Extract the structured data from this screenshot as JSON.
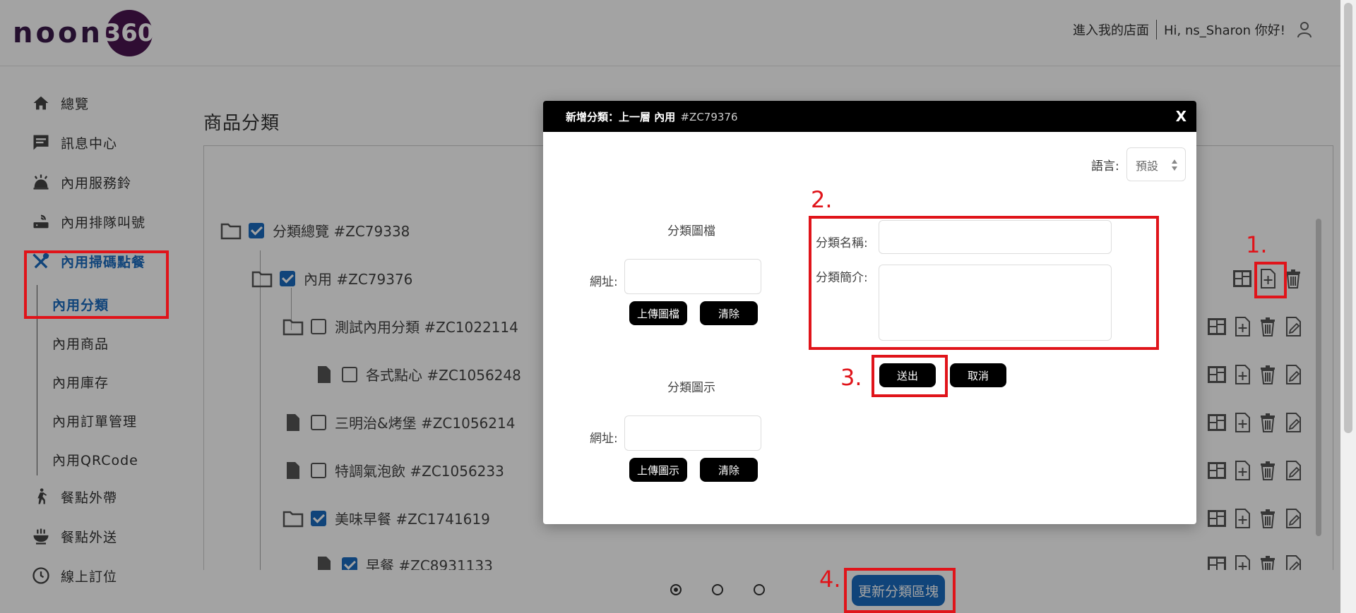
{
  "header": {
    "logo_text": "noon",
    "logo_badge": "360",
    "enter_store": "進入我的店面",
    "greeting": "Hi, ns_Sharon 你好!"
  },
  "sidebar": {
    "items": [
      {
        "label": "總覽",
        "icon": "home-icon"
      },
      {
        "label": "訊息中心",
        "icon": "message-icon"
      },
      {
        "label": "內用服務鈴",
        "icon": "bell-icon"
      },
      {
        "label": "內用排隊叫號",
        "icon": "router-icon"
      },
      {
        "label": "內用掃碼點餐",
        "icon": "utensils-icon"
      }
    ],
    "sub_items": [
      "內用分類",
      "內用商品",
      "內用庫存",
      "內用訂單管理",
      "內用QRCode"
    ],
    "more_items": [
      {
        "label": "餐點外帶",
        "icon": "walk-icon"
      },
      {
        "label": "餐點外送",
        "icon": "bowl-icon"
      },
      {
        "label": "線上訂位",
        "icon": "clock-icon"
      }
    ]
  },
  "main": {
    "title": "商品分類",
    "tree": [
      {
        "label": "分類總覽 #ZC79338",
        "type": "folder",
        "checked": true
      },
      {
        "label": "內用 #ZC79376",
        "type": "folder",
        "checked": true
      },
      {
        "label": "測試內用分類 #ZC1022114",
        "type": "folder",
        "checked": false
      },
      {
        "label": "各式點心 #ZC1056248",
        "type": "file",
        "checked": false
      },
      {
        "label": "三明治&烤堡 #ZC1056214",
        "type": "file",
        "checked": false
      },
      {
        "label": "特調氣泡飲 #ZC1056233",
        "type": "file",
        "checked": false
      },
      {
        "label": "美味早餐 #ZC1741619",
        "type": "folder",
        "checked": true
      },
      {
        "label": "早餐 #ZC8931133",
        "type": "file",
        "checked": true
      }
    ],
    "update_button": "更新分類區塊"
  },
  "modal": {
    "title_prefix": "新增分類：上一層 內用",
    "title_code": "#ZC79376",
    "close": "X",
    "language_label": "語言:",
    "language_value": "預設",
    "image_file_label": "分類圖檔",
    "image_icon_label": "分類圖示",
    "url_label": "網址:",
    "upload_file": "上傳圖檔",
    "upload_icon": "上傳圖示",
    "clear": "清除",
    "name_label": "分類名稱:",
    "desc_label": "分類簡介:",
    "submit": "送出",
    "cancel": "取消"
  },
  "annotations": {
    "n1": "1.",
    "n2": "2.",
    "n3": "3.",
    "n4": "4."
  },
  "colors": {
    "accent": "#1a6bbf",
    "annotation": "#e0141a",
    "brand": "#4a1550"
  }
}
